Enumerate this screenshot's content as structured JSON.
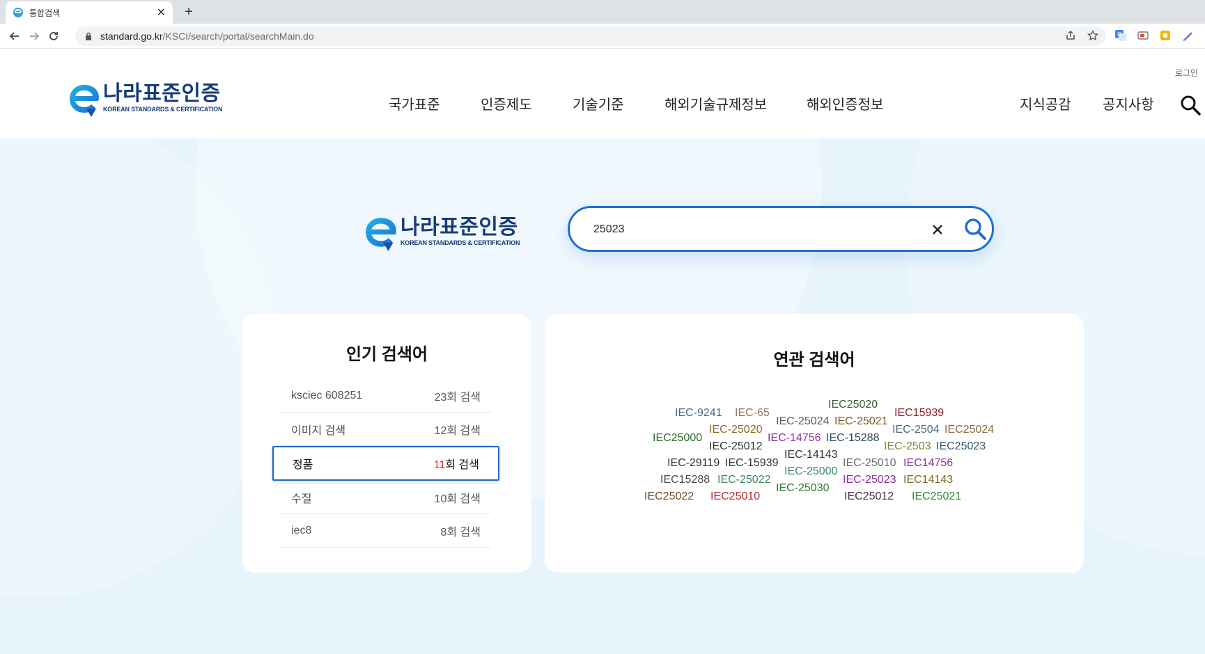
{
  "browser": {
    "tab_title": "통합검색",
    "url_host": "standard.go.kr",
    "url_path": "/KSCI/search/portal/searchMain.do"
  },
  "header": {
    "logo_ko": "나라표준인증",
    "logo_en": "KOREAN STANDARDS & CERTIFICATION",
    "login_label": "로그인",
    "menu": [
      {
        "label": "국가표준"
      },
      {
        "label": "인증제도"
      },
      {
        "label": "기술기준"
      },
      {
        "label": "해외기술규제정보"
      },
      {
        "label": "해외인증정보"
      }
    ],
    "util_menu": [
      {
        "label": "지식공감"
      },
      {
        "label": "공지사항"
      }
    ]
  },
  "search": {
    "logo_ko": "나라표준인증",
    "logo_en": "KOREAN STANDARDS & CERTIFICATION",
    "query": "25023"
  },
  "popular": {
    "title": "인기 검색어",
    "items": [
      {
        "term": "ksciec 608251",
        "count_num": "23",
        "count_suffix": "회 검색"
      },
      {
        "term": "이미지 검색",
        "count_num": "12",
        "count_suffix": "회 검색"
      },
      {
        "term": "정품",
        "count_num": "11",
        "count_suffix": "회 검색"
      },
      {
        "term": "수질",
        "count_num": "10",
        "count_suffix": "회 검색"
      },
      {
        "term": "iec8",
        "count_num": "8",
        "count_suffix": "회 검색"
      }
    ]
  },
  "related": {
    "title": "연관 검색어",
    "tags": [
      {
        "text": "IEC25020",
        "color": "#2f5d3a"
      },
      {
        "text": "IEC-9241",
        "color": "#4a6a7a"
      },
      {
        "text": "IEC-65",
        "color": "#8a7a5a"
      },
      {
        "text": "IEC15939",
        "color": "#8a1f2f"
      },
      {
        "text": "IEC-25024",
        "color": "#5a5a5a"
      },
      {
        "text": "IEC-25021",
        "color": "#7a5a1a"
      },
      {
        "text": "IEC-25020",
        "color": "#8a6a1a"
      },
      {
        "text": "IEC-2504",
        "color": "#4a6a7a"
      },
      {
        "text": "IEC25024",
        "color": "#8a6a3a"
      },
      {
        "text": "IEC25000",
        "color": "#2f6a2f"
      },
      {
        "text": "IEC-14756",
        "color": "#8a2f9a"
      },
      {
        "text": "IEC-15288",
        "color": "#2f4a5a"
      },
      {
        "text": "IEC-25012",
        "color": "#333333"
      },
      {
        "text": "IEC-2503",
        "color": "#7a8a3a"
      },
      {
        "text": "IEC25023",
        "color": "#2f5a6a"
      },
      {
        "text": "IEC-14143",
        "color": "#333333"
      },
      {
        "text": "IEC-29119",
        "color": "#333333"
      },
      {
        "text": "IEC-15939",
        "color": "#333333"
      },
      {
        "text": "IEC-25010",
        "color": "#6a6a6a"
      },
      {
        "text": "IEC14756",
        "color": "#8a2f9a"
      },
      {
        "text": "IEC-25000",
        "color": "#3a8a6a"
      },
      {
        "text": "IEC15288",
        "color": "#4a4a4a"
      },
      {
        "text": "IEC-25022",
        "color": "#3a8a5a"
      },
      {
        "text": "IEC-25023",
        "color": "#8a2f9a"
      },
      {
        "text": "IEC14143",
        "color": "#7a6a1a"
      },
      {
        "text": "IEC-25030",
        "color": "#2f7a2f"
      },
      {
        "text": "IEC25022",
        "color": "#6a4a2a"
      },
      {
        "text": "IEC25010",
        "color": "#b02a2a"
      },
      {
        "text": "IEC25012",
        "color": "#4a2a4a"
      },
      {
        "text": "IEC25021",
        "color": "#2f8a2f"
      }
    ]
  }
}
